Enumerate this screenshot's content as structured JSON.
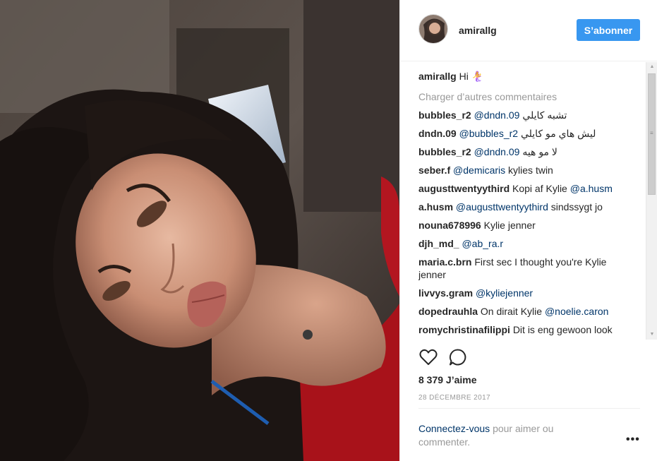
{
  "header": {
    "username": "amirallg",
    "follow_label": "S’abonner"
  },
  "caption": {
    "user": "amirallg",
    "text": "Hi",
    "emoji": "🧜‍♀️"
  },
  "load_more": "Charger d’autres commentaires",
  "comments": [
    {
      "user": "bubbles_r2",
      "mention": "@dndn.09",
      "text": "تشبه كايلي",
      "rtl": true
    },
    {
      "user": "dndn.09",
      "mention": "@bubbles_r2",
      "text": "ليش هاي مو كايلي",
      "rtl": true
    },
    {
      "user": "bubbles_r2",
      "mention": "@dndn.09",
      "text": "لا مو هيه",
      "rtl": true
    },
    {
      "user": "seber.f",
      "mention": "@demicaris",
      "text": "kylies twin"
    },
    {
      "user": "augusttwentyythird",
      "text": "Kopi af Kylie",
      "mention_after": "@a.husm"
    },
    {
      "user": "a.husm",
      "mention": "@augusttwentyythird",
      "text": "sindssygt jo"
    },
    {
      "user": "nouna678996",
      "text": "Kylie jenner"
    },
    {
      "user": "djh_md_",
      "mention": "@ab_ra.r"
    },
    {
      "user": "maria.c.brn",
      "text": "First sec I thought you're Kylie jenner"
    },
    {
      "user": "livvys.gram",
      "mention": "@kyliejenner"
    },
    {
      "user": "dopedrauhla",
      "text": "On dirait Kylie",
      "mention_after": "@noelie.caron"
    },
    {
      "user": "romychristinafilippi",
      "text": "Dit is eng gewoon look"
    }
  ],
  "likes": "8 379 J’aime",
  "date": "28 décembre 2017",
  "login": {
    "link": "Connectez-vous",
    "rest": "pour aimer ou commenter."
  },
  "more_label": "•••",
  "icons": {
    "like": "heart-icon",
    "comment": "comment-bubble-icon",
    "more": "more-options-icon"
  },
  "colors": {
    "follow_button": "#3897f0",
    "mention": "#003569",
    "muted": "#999999"
  }
}
